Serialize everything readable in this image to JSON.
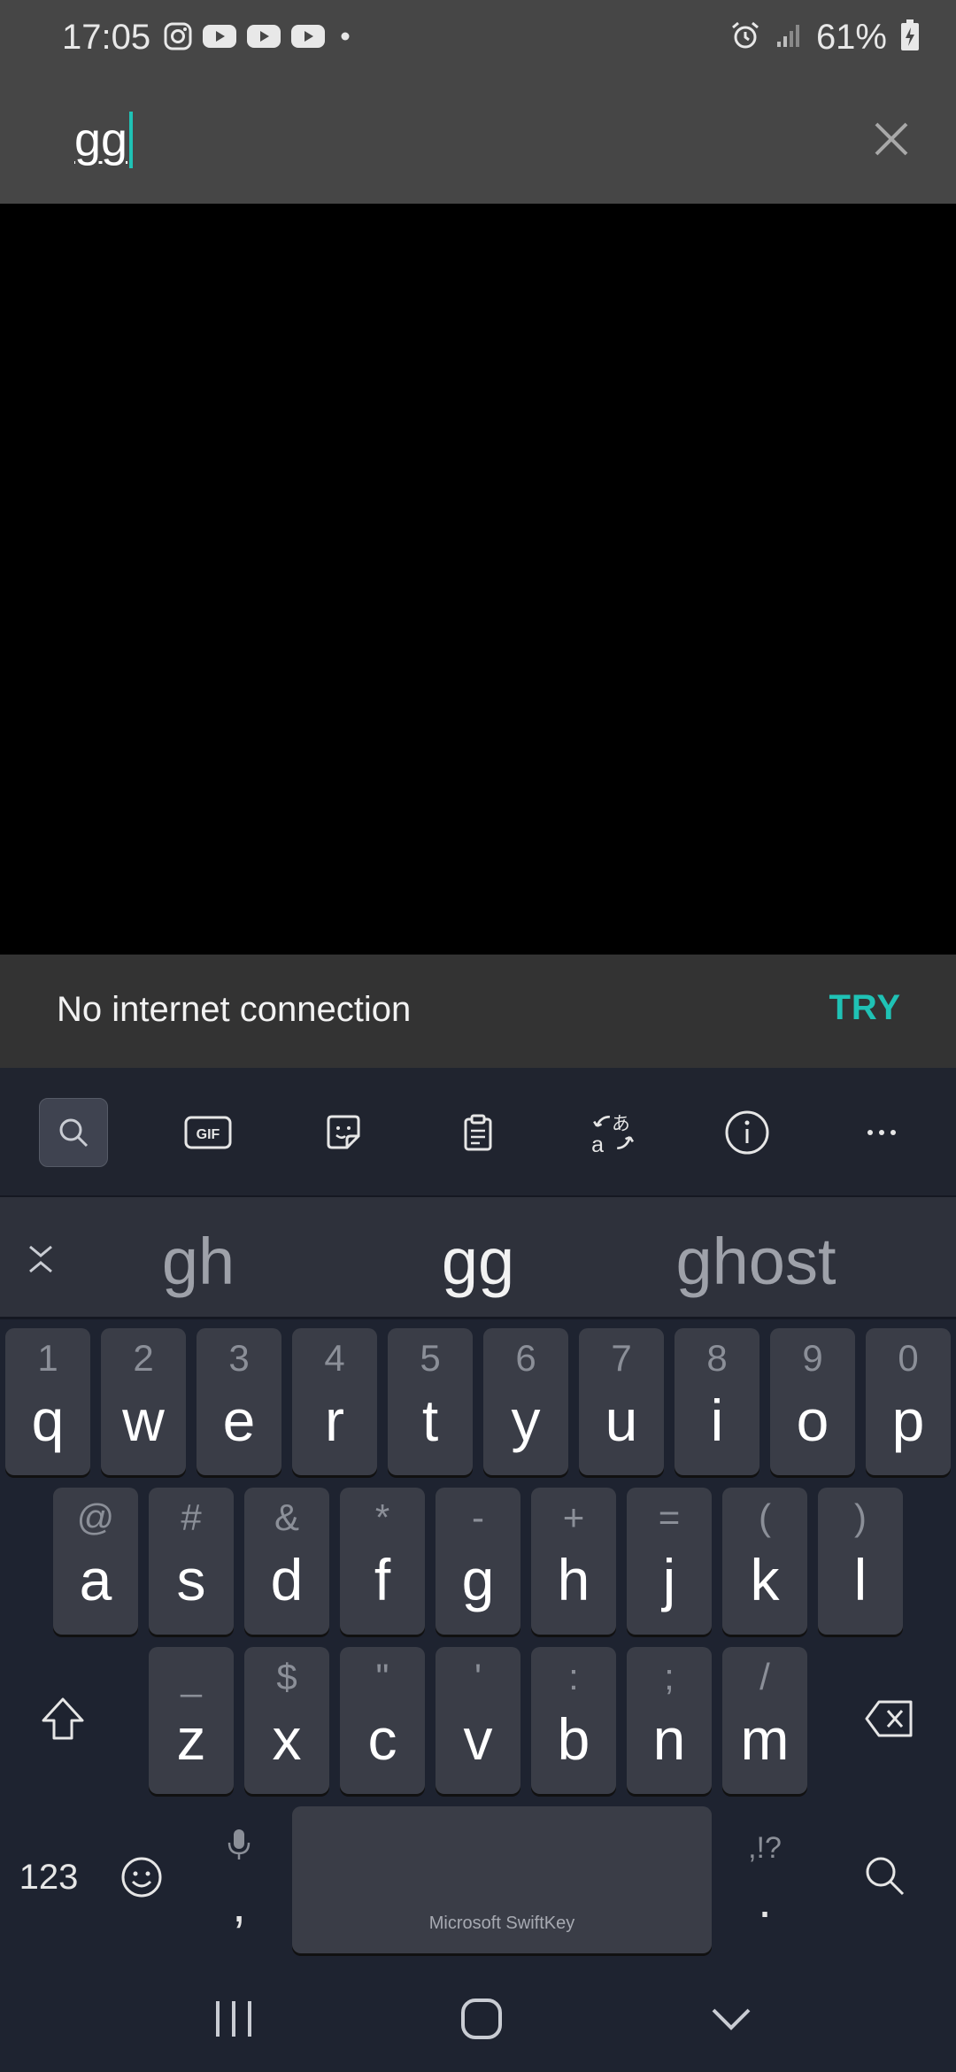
{
  "status_bar": {
    "time": "17:05",
    "icons": [
      "instagram-icon",
      "youtube-icon",
      "youtube-icon",
      "youtube-icon",
      "dot-icon"
    ],
    "right_icons": [
      "alarm-icon",
      "signal-icon"
    ],
    "battery": "61%"
  },
  "search": {
    "value": "gg",
    "clear_icon": "close-icon"
  },
  "snackbar": {
    "message": "No internet connection",
    "action": "TRY"
  },
  "keyboard": {
    "toolbar": [
      "search-icon",
      "gif-icon",
      "sticker-icon",
      "clipboard-icon",
      "translate-icon",
      "info-icon",
      "more-icon"
    ],
    "gif_label": "GIF",
    "suggestions": [
      "gh",
      "gg",
      "ghost"
    ],
    "row1": [
      {
        "hint": "1",
        "key": "q"
      },
      {
        "hint": "2",
        "key": "w"
      },
      {
        "hint": "3",
        "key": "e"
      },
      {
        "hint": "4",
        "key": "r"
      },
      {
        "hint": "5",
        "key": "t"
      },
      {
        "hint": "6",
        "key": "y"
      },
      {
        "hint": "7",
        "key": "u"
      },
      {
        "hint": "8",
        "key": "i"
      },
      {
        "hint": "9",
        "key": "o"
      },
      {
        "hint": "0",
        "key": "p"
      }
    ],
    "row2": [
      {
        "hint": "@",
        "key": "a"
      },
      {
        "hint": "#",
        "key": "s"
      },
      {
        "hint": "&",
        "key": "d"
      },
      {
        "hint": "*",
        "key": "f"
      },
      {
        "hint": "-",
        "key": "g"
      },
      {
        "hint": "+",
        "key": "h"
      },
      {
        "hint": "=",
        "key": "j"
      },
      {
        "hint": "(",
        "key": "k"
      },
      {
        "hint": ")",
        "key": "l"
      }
    ],
    "row3": [
      {
        "hint": "_",
        "key": "z"
      },
      {
        "hint": "$",
        "key": "x"
      },
      {
        "hint": "\"",
        "key": "c"
      },
      {
        "hint": "'",
        "key": "v"
      },
      {
        "hint": ":",
        "key": "b"
      },
      {
        "hint": ";",
        "key": "n"
      },
      {
        "hint": "/",
        "key": "m"
      }
    ],
    "numbers_key": "123",
    "comma": ",",
    "period": ".",
    "punct_hint": ",!?",
    "space_label": "Microsoft SwiftKey"
  },
  "nav": [
    "recents-icon",
    "home-icon",
    "back-icon"
  ]
}
